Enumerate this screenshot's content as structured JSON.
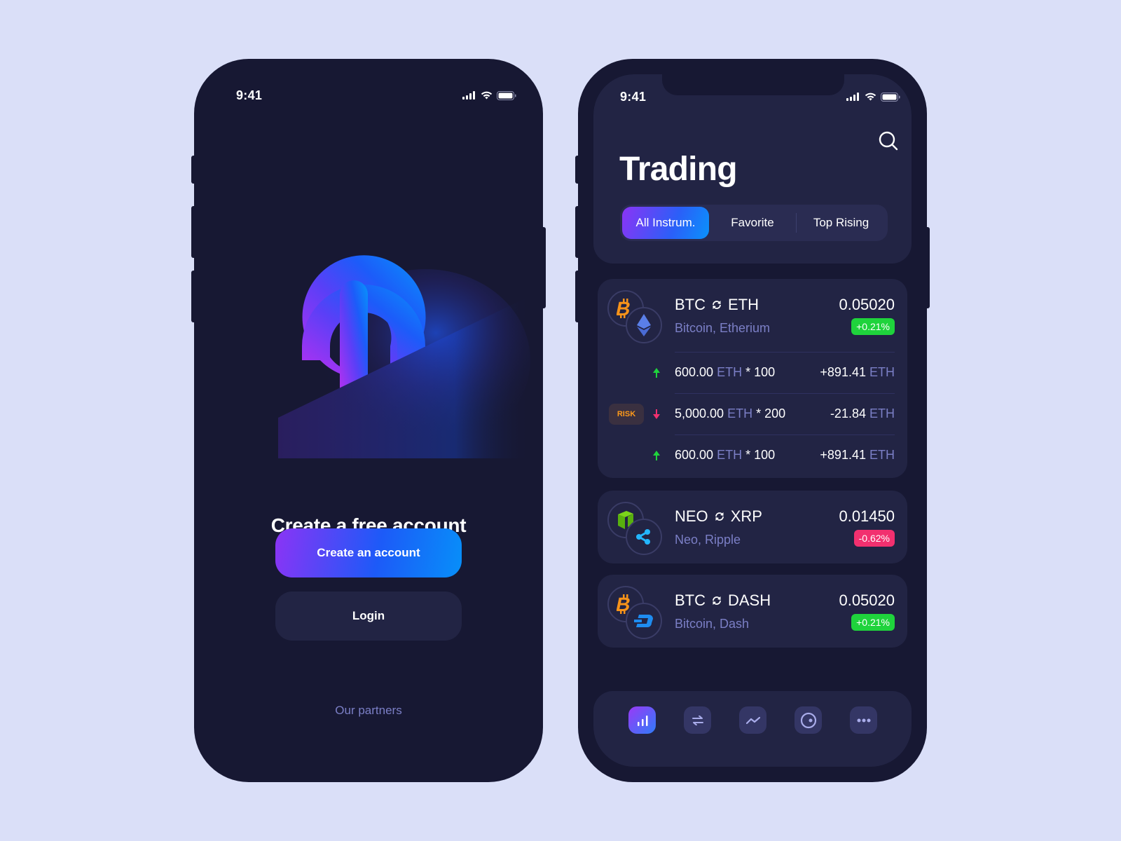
{
  "colors": {
    "background": "#dadff8",
    "phone_body": "#171833",
    "panel": "#222444",
    "accent_purple": "#8b34f5",
    "accent_blue": "#078ff9",
    "muted_text": "#7b7fc6",
    "positive": "#1fd33c",
    "negative": "#f2306f",
    "risk": "#ff9a1a"
  },
  "left_screen": {
    "status_bar": {
      "time": "9:41",
      "icons": [
        "signal-icon",
        "wifi-icon",
        "battery-icon"
      ]
    },
    "logo": "app-logo",
    "headline": "Create a free account",
    "create_button": "Create an account",
    "login_button": "Login",
    "partners_link": "Our partners"
  },
  "right_screen": {
    "status_bar": {
      "time": "9:41",
      "icons": [
        "signal-icon",
        "wifi-icon",
        "battery-icon"
      ]
    },
    "title": "Trading",
    "search_icon": "search-icon",
    "tabs": [
      {
        "label": "All Instrum.",
        "active": true
      },
      {
        "label": "Favorite",
        "active": false
      },
      {
        "label": "Top Rising",
        "active": false
      }
    ],
    "cards": [
      {
        "base": "BTC",
        "quote": "ETH",
        "subtitle": "Bitcoin, Etherium",
        "price": "0.05020",
        "change": "+0.21%",
        "direction": "up",
        "positions": [
          {
            "direction": "up",
            "amount": "600.00",
            "unit": "ETH",
            "multiplier": "* 100",
            "pnl": "+891.41",
            "pnl_unit": "ETH",
            "risk": false
          },
          {
            "direction": "down",
            "amount": "5,000.00",
            "unit": "ETH",
            "multiplier": "* 200",
            "pnl": "-21.84",
            "pnl_unit": "ETH",
            "risk": true,
            "risk_label": "RISK"
          },
          {
            "direction": "up",
            "amount": "600.00",
            "unit": "ETH",
            "multiplier": "* 100",
            "pnl": "+891.41",
            "pnl_unit": "ETH",
            "risk": false
          }
        ]
      },
      {
        "base": "NEO",
        "quote": "XRP",
        "subtitle": "Neo, Ripple",
        "price": "0.01450",
        "change": "-0.62%",
        "direction": "down"
      },
      {
        "base": "BTC",
        "quote": "DASH",
        "subtitle": "Bitcoin, Dash",
        "price": "0.05020",
        "change": "+0.21%",
        "direction": "up"
      }
    ],
    "tabbar": [
      {
        "icon": "bar-chart-icon",
        "active": true
      },
      {
        "icon": "exchange-icon",
        "active": false
      },
      {
        "icon": "trend-icon",
        "active": false
      },
      {
        "icon": "target-icon",
        "active": false
      },
      {
        "icon": "more-icon",
        "active": false
      }
    ]
  }
}
